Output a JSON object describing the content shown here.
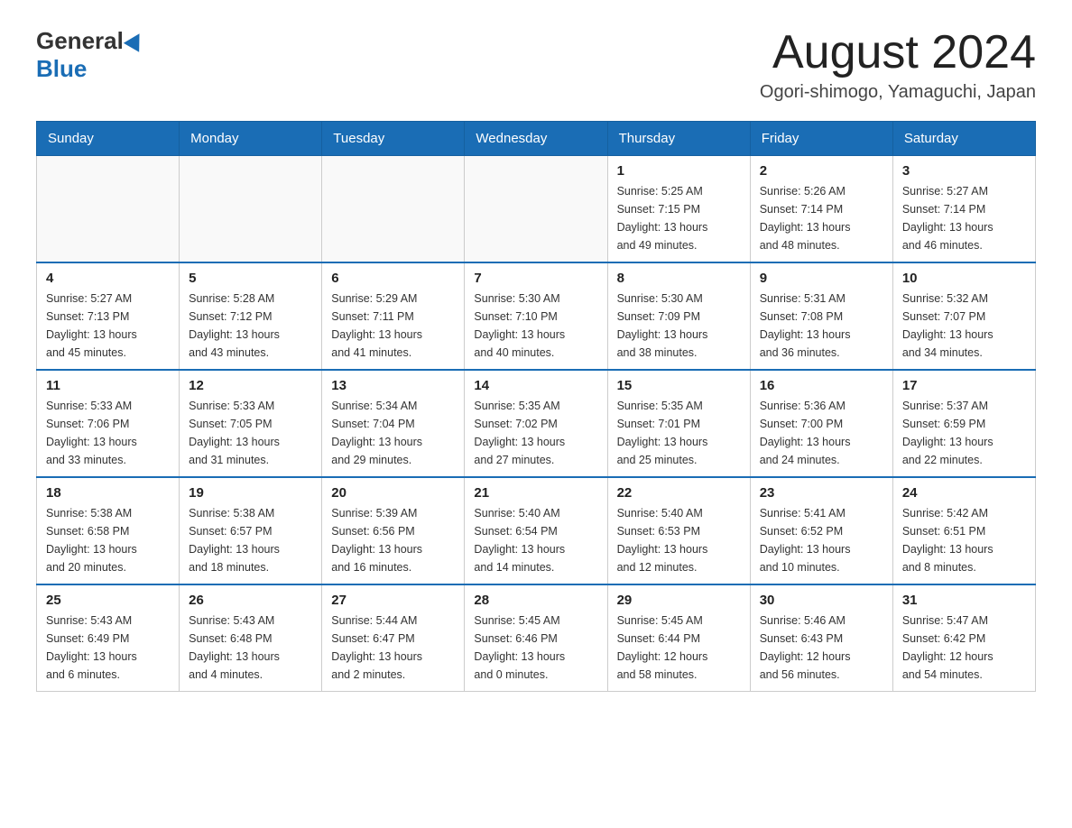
{
  "header": {
    "logo": {
      "general": "General",
      "blue": "Blue"
    },
    "title": "August 2024",
    "subtitle": "Ogori-shimogo, Yamaguchi, Japan"
  },
  "weekdays": [
    "Sunday",
    "Monday",
    "Tuesday",
    "Wednesday",
    "Thursday",
    "Friday",
    "Saturday"
  ],
  "weeks": [
    [
      {
        "day": "",
        "info": ""
      },
      {
        "day": "",
        "info": ""
      },
      {
        "day": "",
        "info": ""
      },
      {
        "day": "",
        "info": ""
      },
      {
        "day": "1",
        "info": "Sunrise: 5:25 AM\nSunset: 7:15 PM\nDaylight: 13 hours\nand 49 minutes."
      },
      {
        "day": "2",
        "info": "Sunrise: 5:26 AM\nSunset: 7:14 PM\nDaylight: 13 hours\nand 48 minutes."
      },
      {
        "day": "3",
        "info": "Sunrise: 5:27 AM\nSunset: 7:14 PM\nDaylight: 13 hours\nand 46 minutes."
      }
    ],
    [
      {
        "day": "4",
        "info": "Sunrise: 5:27 AM\nSunset: 7:13 PM\nDaylight: 13 hours\nand 45 minutes."
      },
      {
        "day": "5",
        "info": "Sunrise: 5:28 AM\nSunset: 7:12 PM\nDaylight: 13 hours\nand 43 minutes."
      },
      {
        "day": "6",
        "info": "Sunrise: 5:29 AM\nSunset: 7:11 PM\nDaylight: 13 hours\nand 41 minutes."
      },
      {
        "day": "7",
        "info": "Sunrise: 5:30 AM\nSunset: 7:10 PM\nDaylight: 13 hours\nand 40 minutes."
      },
      {
        "day": "8",
        "info": "Sunrise: 5:30 AM\nSunset: 7:09 PM\nDaylight: 13 hours\nand 38 minutes."
      },
      {
        "day": "9",
        "info": "Sunrise: 5:31 AM\nSunset: 7:08 PM\nDaylight: 13 hours\nand 36 minutes."
      },
      {
        "day": "10",
        "info": "Sunrise: 5:32 AM\nSunset: 7:07 PM\nDaylight: 13 hours\nand 34 minutes."
      }
    ],
    [
      {
        "day": "11",
        "info": "Sunrise: 5:33 AM\nSunset: 7:06 PM\nDaylight: 13 hours\nand 33 minutes."
      },
      {
        "day": "12",
        "info": "Sunrise: 5:33 AM\nSunset: 7:05 PM\nDaylight: 13 hours\nand 31 minutes."
      },
      {
        "day": "13",
        "info": "Sunrise: 5:34 AM\nSunset: 7:04 PM\nDaylight: 13 hours\nand 29 minutes."
      },
      {
        "day": "14",
        "info": "Sunrise: 5:35 AM\nSunset: 7:02 PM\nDaylight: 13 hours\nand 27 minutes."
      },
      {
        "day": "15",
        "info": "Sunrise: 5:35 AM\nSunset: 7:01 PM\nDaylight: 13 hours\nand 25 minutes."
      },
      {
        "day": "16",
        "info": "Sunrise: 5:36 AM\nSunset: 7:00 PM\nDaylight: 13 hours\nand 24 minutes."
      },
      {
        "day": "17",
        "info": "Sunrise: 5:37 AM\nSunset: 6:59 PM\nDaylight: 13 hours\nand 22 minutes."
      }
    ],
    [
      {
        "day": "18",
        "info": "Sunrise: 5:38 AM\nSunset: 6:58 PM\nDaylight: 13 hours\nand 20 minutes."
      },
      {
        "day": "19",
        "info": "Sunrise: 5:38 AM\nSunset: 6:57 PM\nDaylight: 13 hours\nand 18 minutes."
      },
      {
        "day": "20",
        "info": "Sunrise: 5:39 AM\nSunset: 6:56 PM\nDaylight: 13 hours\nand 16 minutes."
      },
      {
        "day": "21",
        "info": "Sunrise: 5:40 AM\nSunset: 6:54 PM\nDaylight: 13 hours\nand 14 minutes."
      },
      {
        "day": "22",
        "info": "Sunrise: 5:40 AM\nSunset: 6:53 PM\nDaylight: 13 hours\nand 12 minutes."
      },
      {
        "day": "23",
        "info": "Sunrise: 5:41 AM\nSunset: 6:52 PM\nDaylight: 13 hours\nand 10 minutes."
      },
      {
        "day": "24",
        "info": "Sunrise: 5:42 AM\nSunset: 6:51 PM\nDaylight: 13 hours\nand 8 minutes."
      }
    ],
    [
      {
        "day": "25",
        "info": "Sunrise: 5:43 AM\nSunset: 6:49 PM\nDaylight: 13 hours\nand 6 minutes."
      },
      {
        "day": "26",
        "info": "Sunrise: 5:43 AM\nSunset: 6:48 PM\nDaylight: 13 hours\nand 4 minutes."
      },
      {
        "day": "27",
        "info": "Sunrise: 5:44 AM\nSunset: 6:47 PM\nDaylight: 13 hours\nand 2 minutes."
      },
      {
        "day": "28",
        "info": "Sunrise: 5:45 AM\nSunset: 6:46 PM\nDaylight: 13 hours\nand 0 minutes."
      },
      {
        "day": "29",
        "info": "Sunrise: 5:45 AM\nSunset: 6:44 PM\nDaylight: 12 hours\nand 58 minutes."
      },
      {
        "day": "30",
        "info": "Sunrise: 5:46 AM\nSunset: 6:43 PM\nDaylight: 12 hours\nand 56 minutes."
      },
      {
        "day": "31",
        "info": "Sunrise: 5:47 AM\nSunset: 6:42 PM\nDaylight: 12 hours\nand 54 minutes."
      }
    ]
  ]
}
